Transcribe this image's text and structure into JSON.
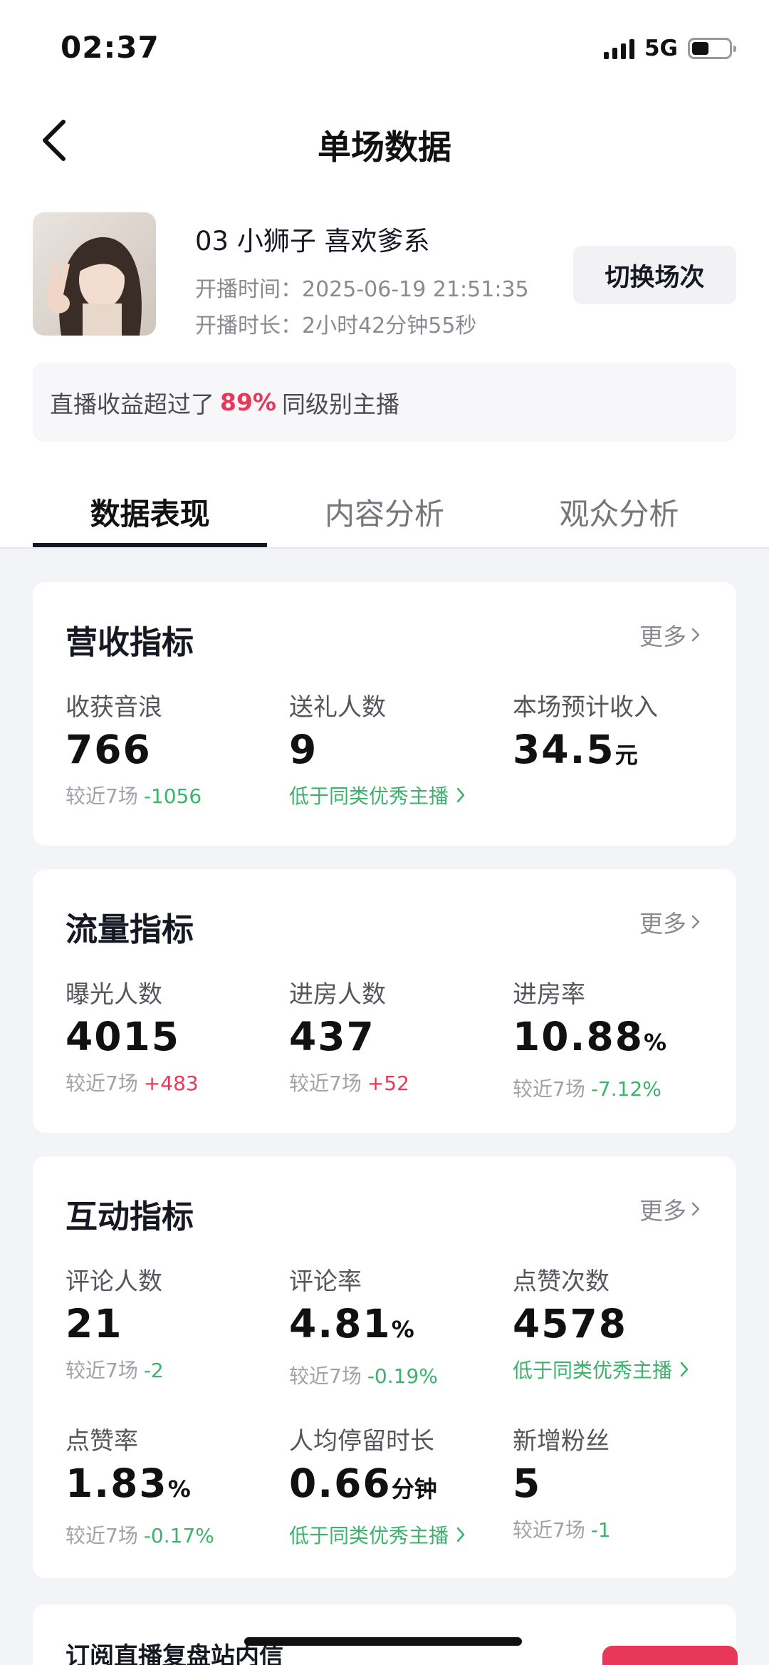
{
  "status_bar": {
    "time": "02:37",
    "network": "5G",
    "battery_level": 0.45
  },
  "header": {
    "title": "单场数据"
  },
  "stream": {
    "name": "03 小狮子 喜欢爹系",
    "start_time": "开播时间：2025-06-19 21:51:35",
    "duration": "开播时长：2小时42分钟55秒",
    "switch_label": "切换场次"
  },
  "rank": {
    "prefix": "直播收益超过了",
    "percent": "89%",
    "suffix": "同级别主播"
  },
  "tabs": [
    {
      "label": "数据表现",
      "active": true
    },
    {
      "label": "内容分析",
      "active": false
    },
    {
      "label": "观众分析",
      "active": false
    }
  ],
  "revenue": {
    "title": "营收指标",
    "more": "更多",
    "items": [
      {
        "label": "收获音浪",
        "value": "766",
        "sub_label": "较近7场",
        "delta": "-1056"
      },
      {
        "label": "送礼人数",
        "value": "9",
        "hint": "低于同类优秀主播"
      },
      {
        "label": "本场预计收入",
        "value": "34.5",
        "unit": "元"
      }
    ]
  },
  "traffic": {
    "title": "流量指标",
    "more": "更多",
    "items": [
      {
        "label": "曝光人数",
        "value": "4015",
        "sub_label": "较近7场",
        "delta": "+483"
      },
      {
        "label": "进房人数",
        "value": "437",
        "sub_label": "较近7场",
        "delta": "+52"
      },
      {
        "label": "进房率",
        "value": "10.88",
        "unit": "%",
        "sub_label": "较近7场",
        "delta": "-7.12%"
      }
    ]
  },
  "interaction": {
    "title": "互动指标",
    "more": "更多",
    "items": [
      {
        "label": "评论人数",
        "value": "21",
        "sub_label": "较近7场",
        "delta": "-2"
      },
      {
        "label": "评论率",
        "value": "4.81",
        "unit": "%",
        "sub_label": "较近7场",
        "delta": "-0.19%"
      },
      {
        "label": "点赞次数",
        "value": "4578",
        "hint": "低于同类优秀主播"
      },
      {
        "label": "点赞率",
        "value": "1.83",
        "unit": "%",
        "sub_label": "较近7场",
        "delta": "-0.17%"
      },
      {
        "label": "人均停留时长",
        "value": "0.66",
        "unit": "分钟",
        "hint": "低于同类优秀主播"
      },
      {
        "label": "新增粉丝",
        "value": "5",
        "sub_label": "较近7场",
        "delta": "-1"
      }
    ]
  },
  "bottom": {
    "text": "订阅直播复盘站内信"
  },
  "colors": {
    "accent": "#e8385a",
    "positive_delta": "#e8385a",
    "negative_delta": "#3bb36b",
    "background": "#f3f4f8"
  }
}
